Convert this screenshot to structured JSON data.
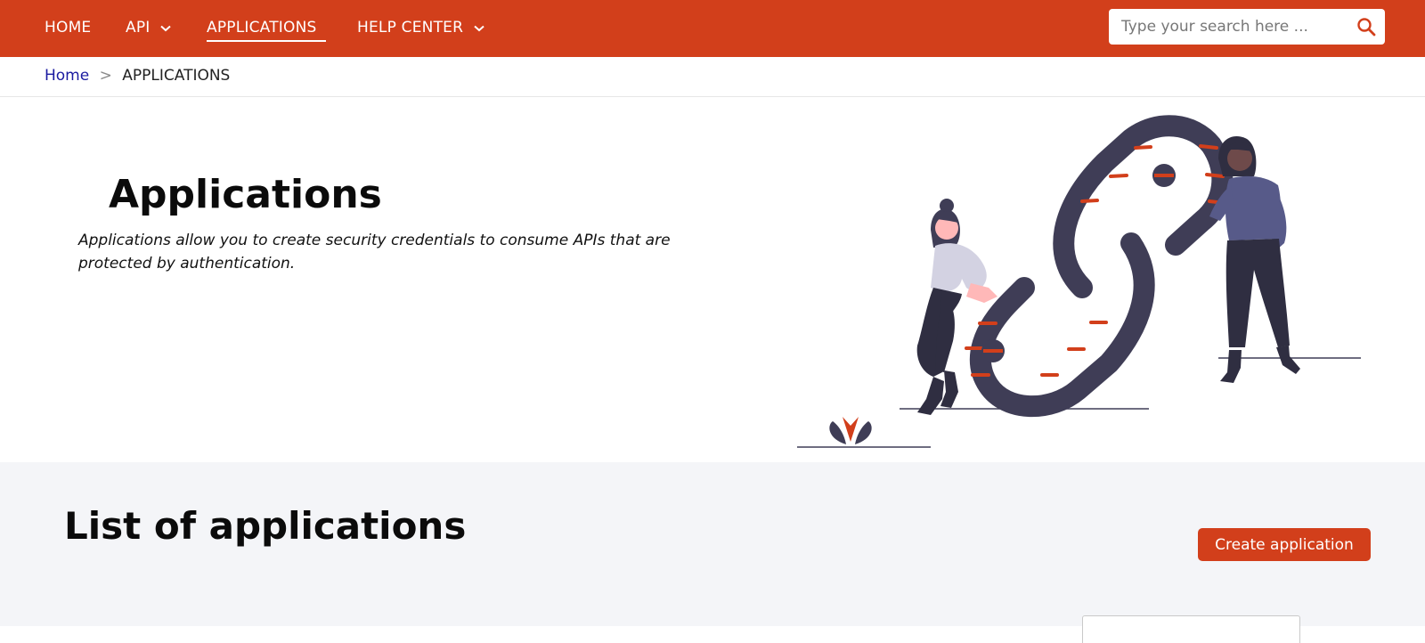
{
  "nav": {
    "items": [
      {
        "label": "HOME",
        "has_dropdown": false,
        "active": false
      },
      {
        "label": "API",
        "has_dropdown": true,
        "active": false
      },
      {
        "label": "APPLICATIONS",
        "has_dropdown": false,
        "active": true
      },
      {
        "label": "HELP CENTER",
        "has_dropdown": true,
        "active": false
      }
    ],
    "search": {
      "placeholder": "Type your search here ...",
      "icon": "search-icon"
    }
  },
  "breadcrumb": {
    "home": "Home",
    "separator": ">",
    "current": "APPLICATIONS"
  },
  "hero": {
    "title": "Applications",
    "description": "Applications allow you to create security credentials to consume APIs that are protected by authentication.",
    "illustration": "two-people-with-chain-link-illustration"
  },
  "list": {
    "title": "List of applications",
    "create_button": "Create application"
  },
  "colors": {
    "brand": "#d23f1b",
    "nav_text": "#ffffff",
    "link": "#1a1aa0",
    "section_bg": "#f4f5f8",
    "illustration_dark": "#3f3d56",
    "illustration_purple": "#575a89"
  }
}
